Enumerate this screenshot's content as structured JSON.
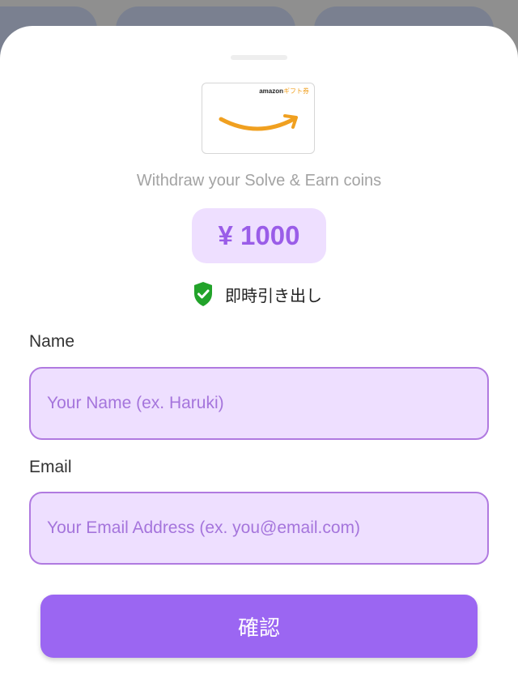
{
  "gift_card": {
    "brand_name": "amazon",
    "brand_tag": "ギフト券",
    "icon": "amazon-smile-logo-icon",
    "accent_color": "#f0a020"
  },
  "header": {
    "subtitle": "Withdraw your Solve & Earn coins"
  },
  "amount": {
    "value": "¥ 1000",
    "color": "#9a5de8"
  },
  "instant_withdrawal": {
    "label": "即時引き出し",
    "icon": "verified-shield-icon",
    "icon_color": "#22a32a"
  },
  "form": {
    "name_label": "Name",
    "name_placeholder": "Your Name (ex. Haruki)",
    "email_label": "Email",
    "email_placeholder": "Your Email Address (ex. you@email.com)"
  },
  "actions": {
    "confirm_label": "確認",
    "button_color": "#9b66f2"
  }
}
